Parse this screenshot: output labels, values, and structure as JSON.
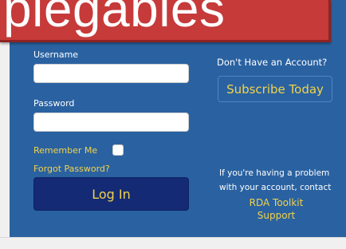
{
  "banner": {
    "text": "plegables"
  },
  "login": {
    "username_label": "Username",
    "username_value": "",
    "password_label": "Password",
    "password_value": "",
    "remember_label": "Remember Me",
    "forgot_label": "Forgot Password?",
    "login_button": "Log In"
  },
  "account": {
    "prompt": "Don't Have an Account?",
    "subscribe_button": "Subscribe Today"
  },
  "help": {
    "line1": "If you're having a problem",
    "line2": "with your account, contact",
    "link_line1": "RDA Toolkit",
    "link_line2": "Support"
  },
  "colors": {
    "panel_blue": "#2a62a1",
    "button_navy": "#142a74",
    "accent_yellow": "#f2d24a",
    "banner_red": "#c63a3a"
  }
}
